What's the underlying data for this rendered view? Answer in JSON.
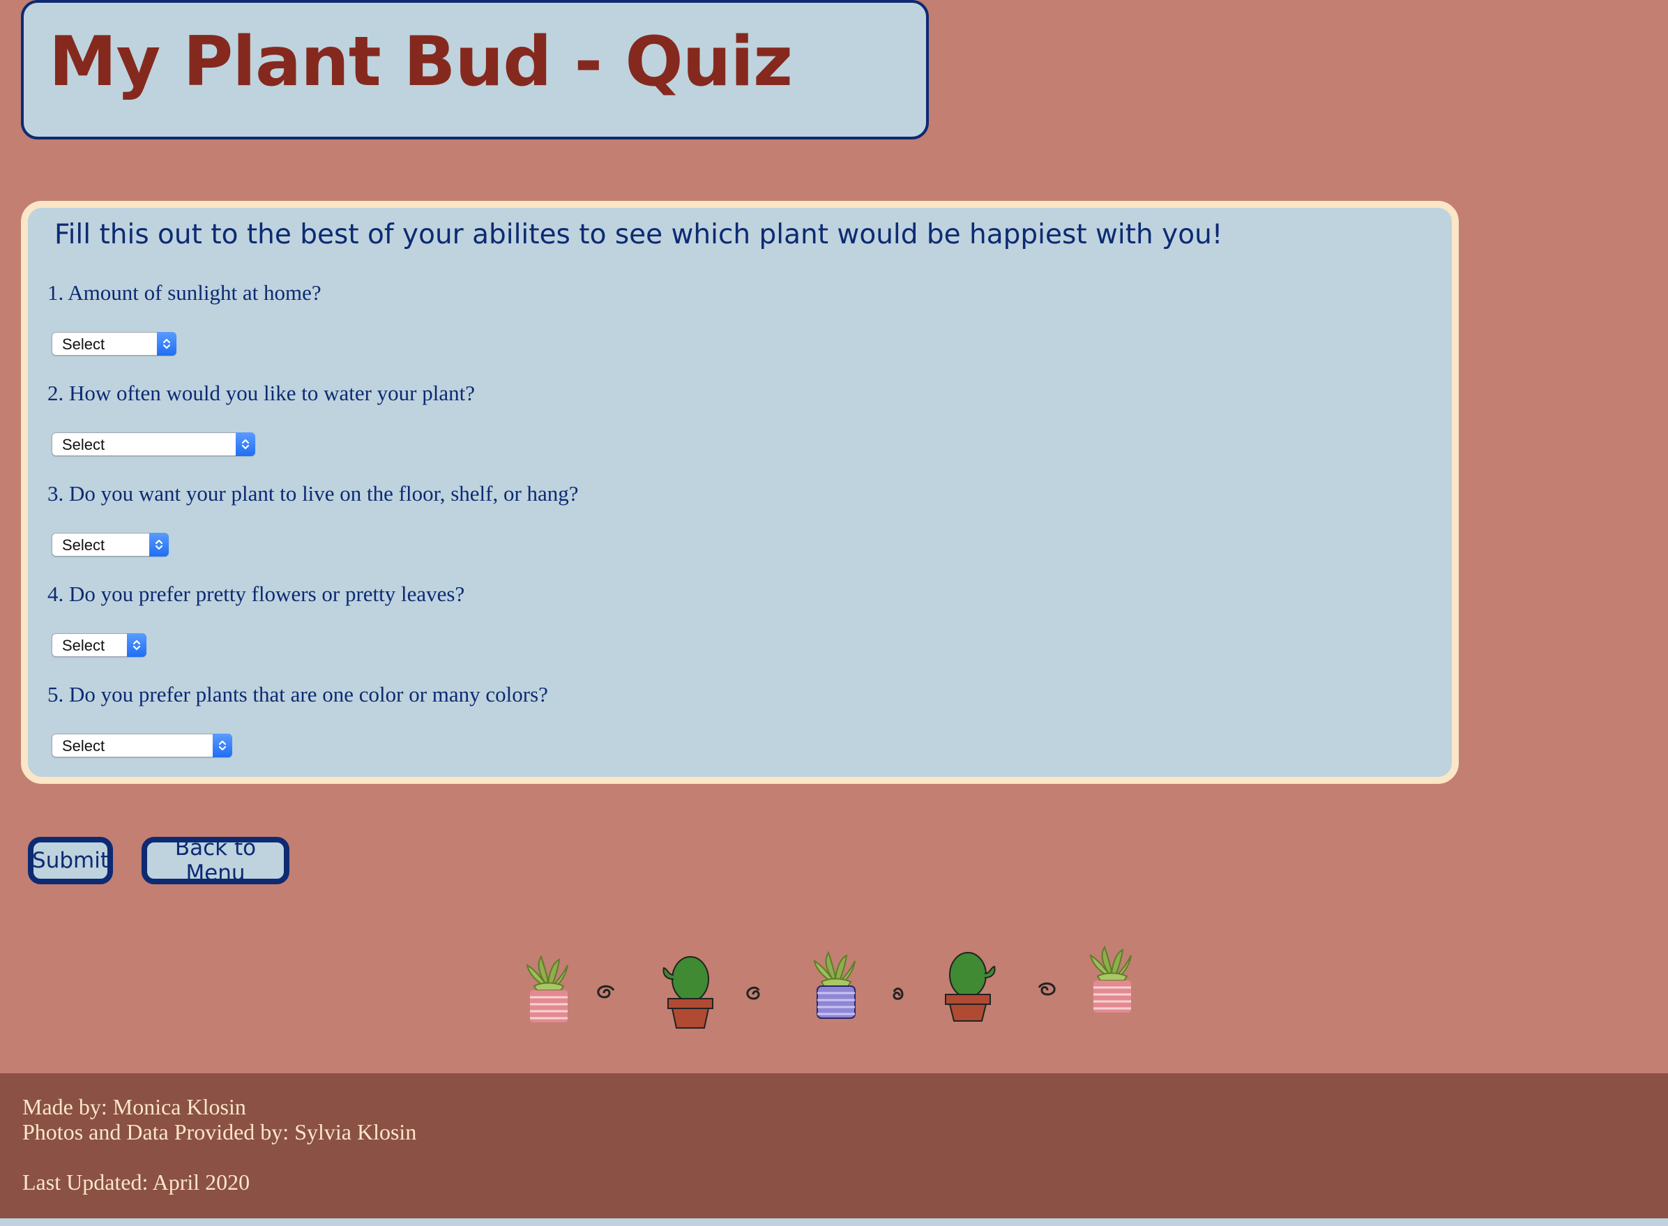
{
  "header": {
    "title": "My Plant Bud - Quiz"
  },
  "quiz": {
    "intro": "Fill this out to the best of your abilites to see which plant would be happiest with you!",
    "questions": [
      {
        "label": "1. Amount of sunlight at home?",
        "selected": "Select"
      },
      {
        "label": "2. How often would you like to water your plant?",
        "selected": "Select"
      },
      {
        "label": "3. Do you want your plant to live on the floor, shelf, or hang?",
        "selected": "Select"
      },
      {
        "label": "4. Do you prefer pretty flowers or pretty leaves?",
        "selected": "Select"
      },
      {
        "label": "5. Do you prefer plants that are one color or many colors?",
        "selected": "Select"
      }
    ]
  },
  "buttons": {
    "submit": "Submit",
    "back": "Back to Menu"
  },
  "decor": {
    "items": [
      "succulent-pink-pot",
      "swirl",
      "cactus",
      "swirl",
      "succulent-blue-pot",
      "swirl",
      "cactus",
      "swirl",
      "succulent-pink-pot"
    ]
  },
  "footer": {
    "made_by": "Made by: Monica Klosin",
    "photos": "Photos and Data Provided by: Sylvia Klosin",
    "updated": "Last Updated: April 2020"
  },
  "colors": {
    "background": "#c27f72",
    "panel": "#bed3dd",
    "navy": "#0d2a73",
    "title_red": "#85291e",
    "cream": "#fbe6c7",
    "footer_bg": "#8a5144"
  }
}
